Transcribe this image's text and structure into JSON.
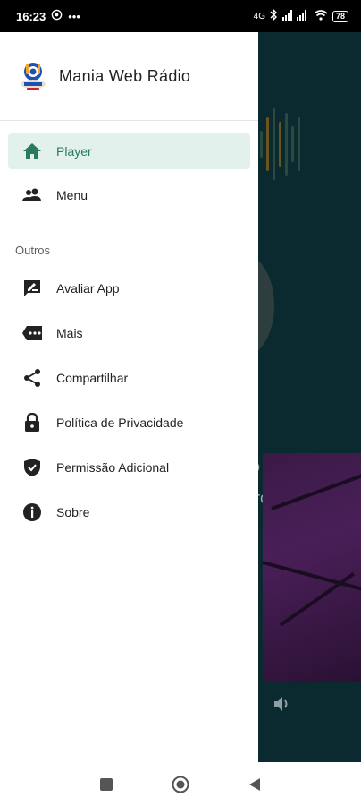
{
  "status_bar": {
    "time": "16:23",
    "battery": "78"
  },
  "drawer": {
    "app_title": "Mania Web Rádio",
    "primary_items": [
      {
        "label": "Player",
        "icon": "home-icon",
        "active": true
      },
      {
        "label": "Menu",
        "icon": "people-icon",
        "active": false
      }
    ],
    "section_label": "Outros",
    "other_items": [
      {
        "label": "Avaliar App",
        "icon": "rate-review-icon"
      },
      {
        "label": "Mais",
        "icon": "more-label-icon"
      },
      {
        "label": "Compartilhar",
        "icon": "share-icon"
      },
      {
        "label": "Política de Privacidade",
        "icon": "lock-icon"
      },
      {
        "label": "Permissão Adicional",
        "icon": "shield-check-icon"
      },
      {
        "label": "Sobre",
        "icon": "info-icon"
      }
    ]
  },
  "background": {
    "text_line_1": "o",
    "text_line_2": "iro"
  },
  "colors": {
    "accent": "#2b7a5e",
    "active_bg": "#e3f1ec",
    "background_app": "#0b2a30"
  }
}
